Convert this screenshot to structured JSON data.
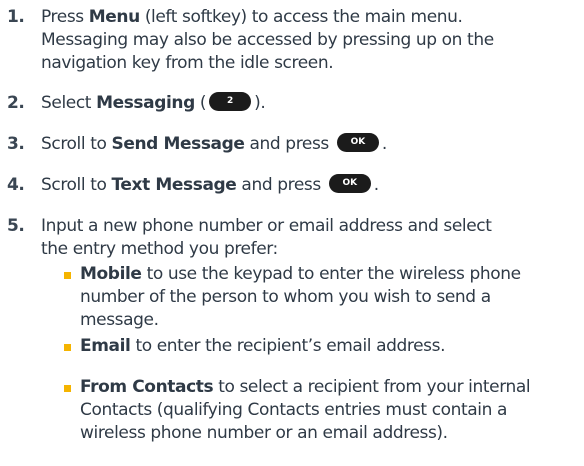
{
  "steps": [
    {
      "num": "1.",
      "t1": "Press ",
      "b1": "Menu",
      "t2": " (left softkey) to access the main menu.",
      "line2": "Messaging may also be accessed by pressing up on the",
      "line3": "navigation key from the idle screen."
    },
    {
      "num": "2.",
      "t1": "Select ",
      "b1": "Messaging",
      "t2": " (",
      "key": "2",
      "t3": ")."
    },
    {
      "num": "3.",
      "t1": "Scroll to ",
      "b1": "Send Message",
      "t2": " and press ",
      "key": "OK",
      "t3": "."
    },
    {
      "num": "4.",
      "t1": "Scroll to ",
      "b1": "Text Message",
      "t2": " and press ",
      "key": "OK",
      "t3": "."
    },
    {
      "num": "5.",
      "line1": "Input a new phone number or email address and select",
      "line2": "the entry method you prefer:"
    }
  ],
  "bullets": [
    {
      "b": "Mobile",
      "t": " to use the keypad to enter the wireless phone",
      "line2": "number of the person to whom you wish to send a",
      "line3": "message."
    },
    {
      "b": "Email",
      "t": " to enter the recipient’s email address."
    },
    {
      "b": "From Contacts",
      "t": " to select a recipient from your internal",
      "line2": "Contacts (qualifying Contacts entries must contain a",
      "line3": "wireless phone number or an email address)."
    }
  ],
  "colors": {
    "text": "#2f3a46",
    "bullet": "#f5b400",
    "key_bg": "#1b1b1b"
  }
}
